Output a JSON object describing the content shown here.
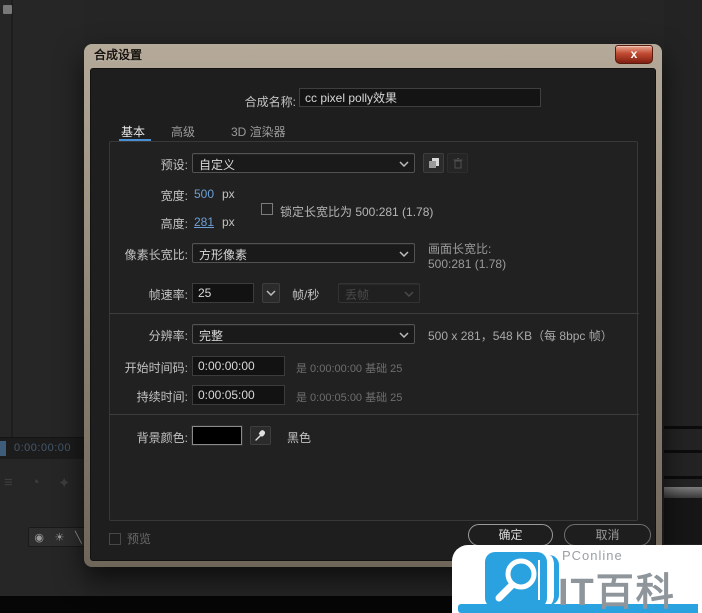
{
  "colors": {
    "accent_blue": "#6c9fd4",
    "tab_underline": "#4a8fd2",
    "titlebar_beige": "#b5aa99",
    "close_red": "#c14a30",
    "dialog_bg": "#1e1e1e",
    "watermark_blue": "#2aa2df",
    "background_color_value": "#000000"
  },
  "app": {
    "timecode": "0:00:00:00",
    "toolbar_icons": [
      "circle-icon",
      "sun-icon",
      "slash-icon"
    ]
  },
  "dialog": {
    "title": "合成设置",
    "close": "x",
    "name": {
      "label": "合成名称:",
      "value": "cc pixel polly效果"
    },
    "tabs": [
      {
        "label": "基本"
      },
      {
        "label": "高级"
      },
      {
        "label": "3D 渲染器"
      }
    ],
    "preset": {
      "label": "预设:",
      "value": "自定义"
    },
    "width_row": {
      "label": "宽度:",
      "value": "500",
      "unit": "px"
    },
    "height_row": {
      "label": "高度:",
      "value": "281",
      "unit": "px"
    },
    "lock_aspect": {
      "label": "锁定长宽比为 500:281 (1.78)",
      "checked": false
    },
    "pixel_aspect": {
      "label": "像素长宽比:",
      "value": "方形像素"
    },
    "frame_aspect": {
      "label": "画面长宽比:",
      "value": "500:281 (1.78)"
    },
    "frame_rate": {
      "label": "帧速率:",
      "value": "25",
      "unit": "帧/秒",
      "drop_frame": "丢帧"
    },
    "resolution": {
      "label": "分辨率:",
      "value": "完整",
      "info": "500 x 281，548 KB（每 8bpc 帧）"
    },
    "start_timecode": {
      "label": "开始时间码:",
      "value": "0:00:00:00",
      "info": "是 0:00:00:00   基础 25"
    },
    "duration": {
      "label": "持续时间:",
      "value": "0:00:05:00",
      "info": "是 0:00:05:00   基础 25"
    },
    "background_color": {
      "label": "背景颜色:",
      "name": "黑色"
    },
    "preview": {
      "label": "预览",
      "checked": false
    },
    "buttons": {
      "ok": "确定",
      "cancel": "取消"
    }
  },
  "watermark": {
    "brand": "PConline",
    "title": "IT百科"
  }
}
